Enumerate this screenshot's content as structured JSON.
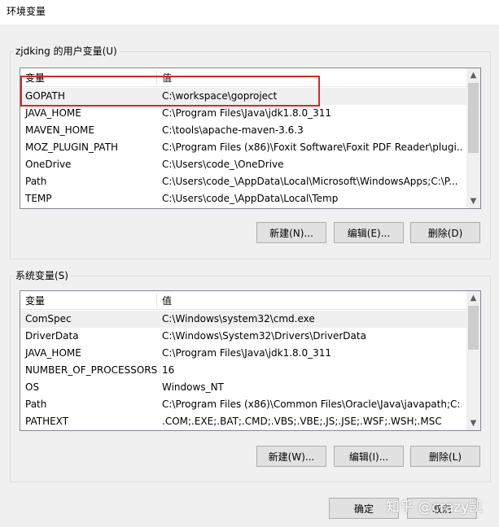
{
  "window": {
    "title": "环境变量"
  },
  "user_vars": {
    "group_label": "zjdking 的用户变量(U)",
    "columns": [
      "变量",
      "值"
    ],
    "rows": [
      {
        "name": "GOPATH",
        "value": "C:\\workspace\\goproject"
      },
      {
        "name": "JAVA_HOME",
        "value": "C:\\Program Files\\Java\\jdk1.8.0_311"
      },
      {
        "name": "MAVEN_HOME",
        "value": "C:\\tools\\apache-maven-3.6.3"
      },
      {
        "name": "MOZ_PLUGIN_PATH",
        "value": "C:\\Program Files (x86)\\Foxit Software\\Foxit PDF Reader\\plugi..."
      },
      {
        "name": "OneDrive",
        "value": "C:\\Users\\code_\\OneDrive"
      },
      {
        "name": "Path",
        "value": "C:\\Users\\code_\\AppData\\Local\\Microsoft\\WindowsApps;C:\\P..."
      },
      {
        "name": "TEMP",
        "value": "C:\\Users\\code_\\AppData\\Local\\Temp"
      }
    ],
    "buttons": {
      "new": "新建(N)...",
      "edit": "编辑(E)...",
      "delete": "删除(D)"
    }
  },
  "system_vars": {
    "group_label": "系统变量(S)",
    "columns": [
      "变量",
      "值"
    ],
    "rows": [
      {
        "name": "ComSpec",
        "value": "C:\\Windows\\system32\\cmd.exe"
      },
      {
        "name": "DriverData",
        "value": "C:\\Windows\\System32\\Drivers\\DriverData"
      },
      {
        "name": "JAVA_HOME",
        "value": "C:\\Program Files\\Java\\jdk1.8.0_311"
      },
      {
        "name": "NUMBER_OF_PROCESSORS",
        "value": "16"
      },
      {
        "name": "OS",
        "value": "Windows_NT"
      },
      {
        "name": "Path",
        "value": "C:\\Program Files (x86)\\Common Files\\Oracle\\Java\\javapath;C:..."
      },
      {
        "name": "PATHEXT",
        "value": ".COM;.EXE;.BAT;.CMD;.VBS;.VBE;.JS;.JSE;.WSF;.WSH;.MSC"
      }
    ],
    "buttons": {
      "new": "新建(W)...",
      "edit": "编辑(I)...",
      "delete": "删除(L)"
    }
  },
  "footer": {
    "ok": "确定",
    "cancel": "取消"
  },
  "watermark": "知乎 @crazy凯",
  "colors": {
    "highlight": "#d02a2a",
    "selected_row": "#f0f0f0"
  }
}
